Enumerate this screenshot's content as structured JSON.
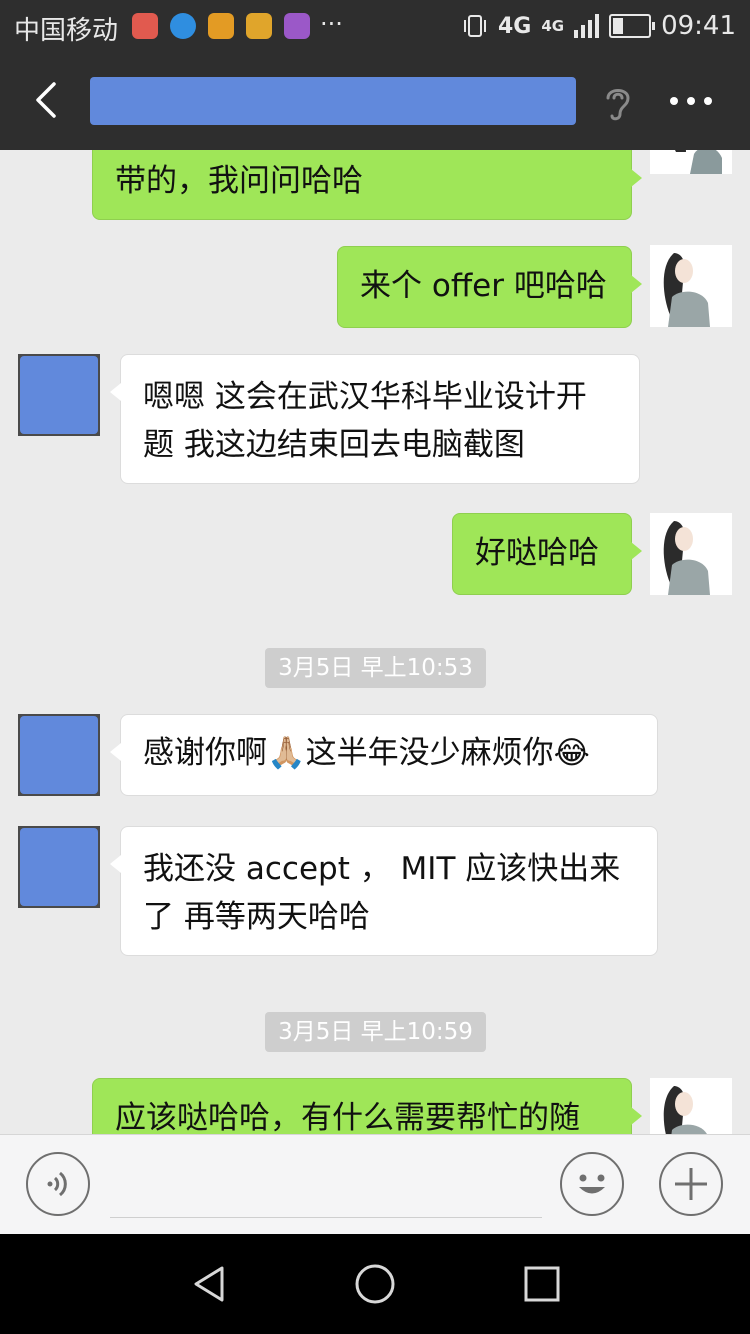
{
  "status_bar": {
    "carrier": "中国移动",
    "network_1": "4G",
    "network_2": "4G",
    "time": "09:41",
    "battery_level": 0.3,
    "notification_icons": [
      "missed-call-icon",
      "chat-bubble-icon",
      "lock-icon",
      "wifi-icon",
      "gallery-icon"
    ],
    "more_indicator": "···"
  },
  "title_bar": {
    "back_icon": "chevron-left-icon",
    "title_redacted": true,
    "voice_icon": "ear-icon",
    "more_icon": "more-dots-icon"
  },
  "messages": [
    {
      "sender": "me",
      "text": "带的，我问问哈哈"
    },
    {
      "sender": "me",
      "text": "来个 offer 吧哈哈"
    },
    {
      "sender": "them",
      "text": "嗯嗯 这会在武汉华科毕业设计开题 我这边结束回去电脑截图"
    },
    {
      "sender": "me",
      "text": "好哒哈哈"
    },
    {
      "type": "timestamp",
      "text": "3月5日 早上10:53"
    },
    {
      "sender": "them",
      "text": "感谢你啊🙏🏼这半年没少麻烦你😂"
    },
    {
      "sender": "them",
      "text": "我还没 accept ， MIT 应该快出来了 再等两天哈哈"
    },
    {
      "type": "timestamp",
      "text": "3月5日 早上10:59"
    },
    {
      "sender": "me",
      "text": "应该哒哈哈，有什么需要帮忙的随"
    }
  ],
  "input_bar": {
    "voice_icon": "voice-input-icon",
    "emoji_icon": "emoji-icon",
    "plus_icon": "plus-icon"
  },
  "colors": {
    "my_bubble": "#9fe658",
    "their_bubble": "#ffffff",
    "title_bar": "#2e2e2e",
    "chat_bg": "#ebebeb",
    "redaction": "#6189dc"
  }
}
